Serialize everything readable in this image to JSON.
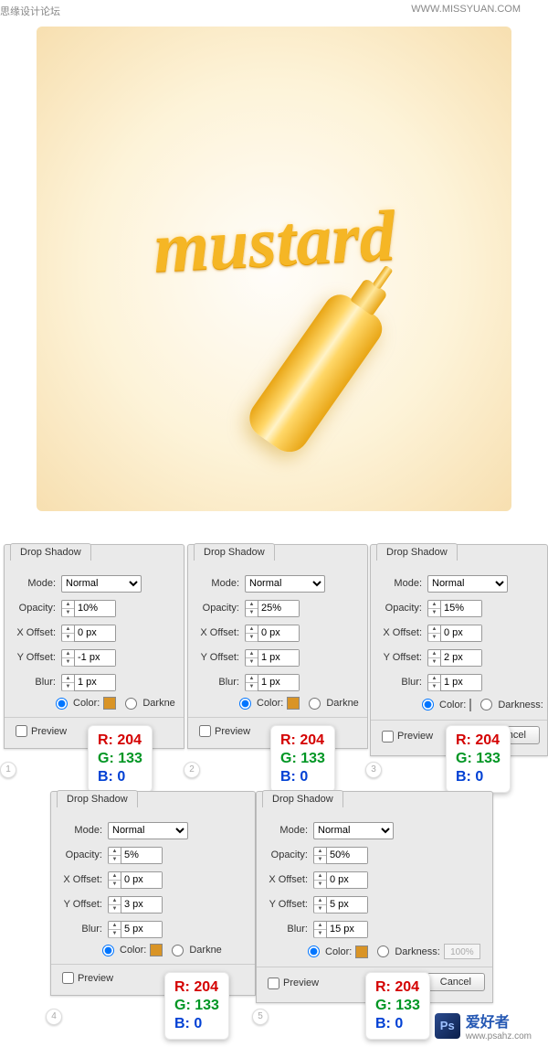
{
  "header": {
    "left": "思缘设计论坛",
    "right": "WWW.MISSYUAN.COM"
  },
  "art": {
    "word": "mustard"
  },
  "tab": "Drop Shadow",
  "labels": {
    "mode": "Mode:",
    "opacity": "Opacity:",
    "xoff": "X Offset:",
    "yoff": "Y Offset:",
    "blur": "Blur:",
    "color": "Color:",
    "dark": "Darkne",
    "darkfull": "Darkness:",
    "preview": "Preview",
    "cancel": "Cancel"
  },
  "mode": "Normal",
  "panels": [
    {
      "opacity": "10%",
      "x": "0 px",
      "y": "-1 px",
      "blur": "1 px"
    },
    {
      "opacity": "25%",
      "x": "0 px",
      "y": "1 px",
      "blur": "1 px"
    },
    {
      "opacity": "15%",
      "x": "0 px",
      "y": "2 px",
      "blur": "1 px"
    },
    {
      "opacity": "5%",
      "x": "0 px",
      "y": "3 px",
      "blur": "5 px"
    },
    {
      "opacity": "50%",
      "x": "0 px",
      "y": "5 px",
      "blur": "15 px"
    }
  ],
  "rgb": {
    "r": "R: 204",
    "g": "G: 133",
    "b": "B: 0"
  },
  "dval": "100%",
  "footer": {
    "logo": "Ps",
    "zh": "爱好者",
    "url": "www.psahz.com"
  }
}
